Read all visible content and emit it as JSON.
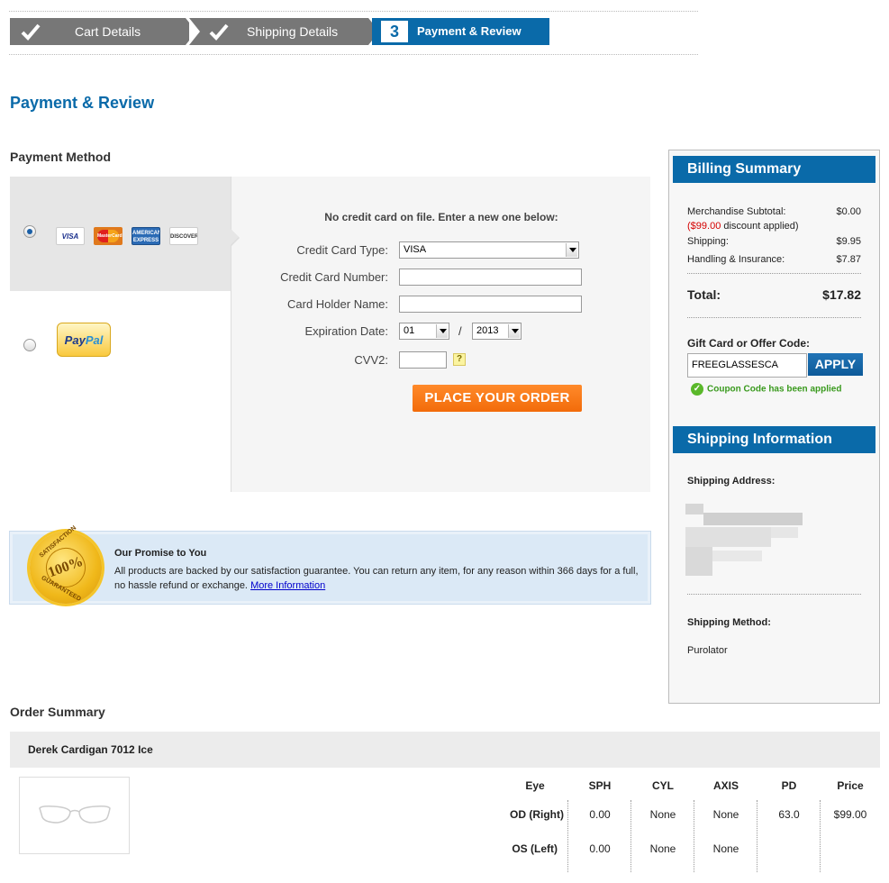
{
  "steps": [
    {
      "label": "Cart Details",
      "state": "done"
    },
    {
      "label": "Shipping Details",
      "state": "done"
    },
    {
      "number": "3",
      "label": "Payment & Review",
      "state": "active"
    }
  ],
  "page_title": "Payment & Review",
  "payment": {
    "heading": "Payment Method",
    "cards": [
      "VISA",
      "MasterCard",
      "AMERICAN EXPRESS",
      "DISCOVER"
    ],
    "paypal": {
      "pay": "Pay",
      "pal": "Pal"
    },
    "no_card_msg": "No credit card on file. Enter a new one below:",
    "fields": {
      "card_type_label": "Credit Card Type:",
      "card_type_value": "VISA",
      "card_number_label": "Credit Card Number:",
      "card_number_value": "",
      "holder_label": "Card Holder Name:",
      "holder_value": "",
      "expiry_label": "Expiration Date:",
      "expiry_month": "01",
      "expiry_sep": "/",
      "expiry_year": "2013",
      "cvv_label": "CVV2:",
      "cvv_value": "",
      "cvv_help": "?"
    },
    "place_order_label": "PLACE YOUR ORDER"
  },
  "promise": {
    "seal_top": "SATISFACTION",
    "seal_center": "100%",
    "seal_bottom": "GUARANTEED",
    "title": "Our Promise to You",
    "text": "All products are backed by our satisfaction guarantee. You can return any item, for any reason within 366 days for a full, no hassle refund or exchange.",
    "link": "More Information"
  },
  "billing": {
    "heading": "Billing Summary",
    "subtotal_label": "Merchandise Subtotal:",
    "subtotal_value": "$0.00",
    "discount_amount": "($99.00",
    "discount_text": "discount applied)",
    "shipping_label": "Shipping:",
    "shipping_value": "$9.95",
    "handling_label": "Handling & Insurance:",
    "handling_value": "$7.87",
    "total_label": "Total:",
    "total_value": "$17.82",
    "gift_label": "Gift Card or Offer Code:",
    "gift_value": "FREEGLASSESCA",
    "apply_label": "APPLY",
    "coupon_msg": "Coupon Code has been applied"
  },
  "shipping_info": {
    "heading": "Shipping Information",
    "address_label": "Shipping Address:",
    "method_label": "Shipping Method:",
    "method_value": "Purolator"
  },
  "order_summary": {
    "heading": "Order Summary",
    "product_name": "Derek Cardigan 7012 Ice",
    "columns": [
      "Eye",
      "SPH",
      "CYL",
      "AXIS",
      "PD",
      "Price"
    ],
    "rows": [
      {
        "eye": "OD (Right)",
        "sph": "0.00",
        "cyl": "None",
        "axis": "None",
        "pd": "63.0",
        "price": "$99.00"
      },
      {
        "eye": "OS (Left)",
        "sph": "0.00",
        "cyl": "None",
        "axis": "None",
        "pd": "",
        "price": ""
      }
    ]
  },
  "colors": {
    "brand_blue": "#0a6aa9",
    "step_grey": "#777777",
    "order_orange": "#f26b0a",
    "success_green": "#3a9a1e",
    "discount_red": "#d40000"
  }
}
